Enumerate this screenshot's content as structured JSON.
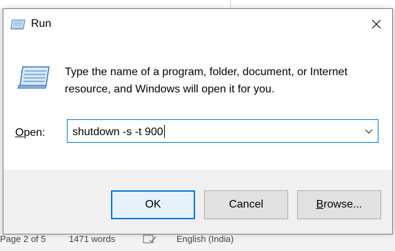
{
  "background": {
    "status_page": "Page 2 of 5",
    "status_words": "1471 words",
    "status_language": "English (India)"
  },
  "dialog": {
    "title": "Run",
    "icon": "run-icon",
    "close_icon": "close-icon",
    "description": "Type the name of a program, folder, document, or Internet resource, and Windows will open it for you.",
    "open_label_accel": "O",
    "open_label_rest": "pen:",
    "open_value": "shutdown -s -t 900",
    "dropdown_icon": "chevron-down-icon"
  },
  "buttons": {
    "ok": "OK",
    "cancel": "Cancel",
    "browse_accel": "B",
    "browse_rest": "rowse..."
  },
  "colors": {
    "accent": "#0078d7",
    "footer": "#f0f0f0",
    "button": "#e1e1e1"
  }
}
